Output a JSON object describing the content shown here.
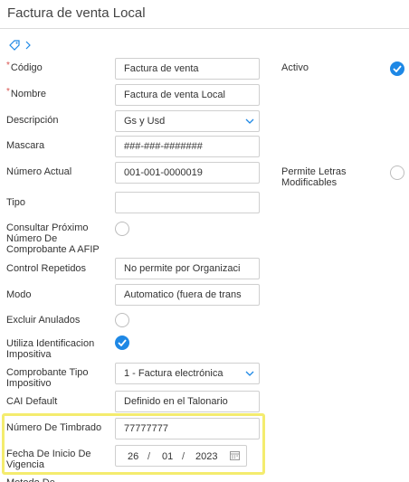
{
  "header": {
    "title": "Factura de venta Local"
  },
  "fields": {
    "codigo": {
      "label": "Código",
      "value": "Factura de venta"
    },
    "nombre": {
      "label": "Nombre",
      "value": "Factura de venta Local"
    },
    "descripcion": {
      "label": "Descripción",
      "value": "Gs y Usd"
    },
    "mascara": {
      "label": "Mascara",
      "value": "###-###-#######"
    },
    "numero_actual": {
      "label": "Número Actual",
      "value": "001-001-0000019"
    },
    "tipo": {
      "label": "Tipo",
      "value": ""
    },
    "consultar": {
      "label_lines": [
        "Consultar Próximo",
        "Número De",
        "Comprobante A AFIP"
      ]
    },
    "control_repetidos": {
      "label": "Control Repetidos",
      "value": "No permite por Organizaci"
    },
    "modo": {
      "label": "Modo",
      "value": "Automatico (fuera de trans"
    },
    "excluir_anulados": {
      "label": "Excluir Anulados"
    },
    "utiliza": {
      "label_lines": [
        "Utiliza Identificacion",
        "Impositiva"
      ]
    },
    "comprobante_tipo": {
      "label_lines": [
        "Comprobante Tipo",
        "Impositivo"
      ],
      "value": "1 - Factura electrónica"
    },
    "cai_default": {
      "label": "CAI Default",
      "value": "Definido en el Talonario"
    },
    "numero_timbrado": {
      "label": "Número De Timbrado",
      "value": "77777777"
    },
    "fecha_inicio": {
      "label_lines": [
        "Fecha De Inicio De",
        "Vigencia"
      ],
      "day": "26",
      "month": "01",
      "year": "2023",
      "sep": "/"
    },
    "next_cut_label": "Metodo De..."
  },
  "right": {
    "activo": {
      "label": "Activo",
      "checked": true
    },
    "permite": {
      "label_lines": [
        "Permite Letras",
        "Modificables"
      ],
      "checked": false
    }
  },
  "required_mark": "*",
  "colors": {
    "accent": "#1e88e5",
    "highlight": "#f4ec6e",
    "required": "#d9534f"
  }
}
